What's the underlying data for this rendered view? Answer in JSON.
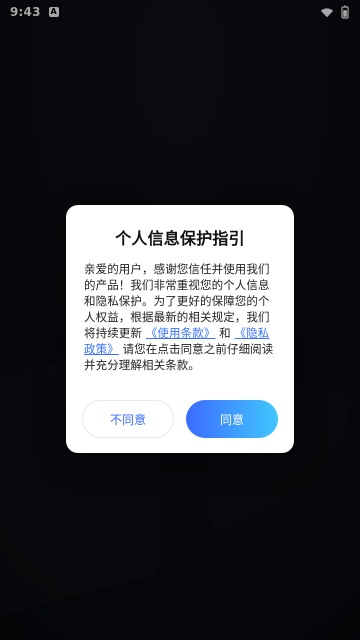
{
  "status_bar": {
    "time": "9:43",
    "indicator_letter": "A"
  },
  "dialog": {
    "title": "个人信息保护指引",
    "body_part1": "亲爱的用户，感谢您信任并使用我们的产品！我们非常重视您的个人信息和隐私保护。为了更好的保障您的个人权益，根据最新的相关规定，我们将持续更新",
    "terms_link": "《使用条款》",
    "and_text": "和",
    "privacy_link": "《隐私政策》",
    "body_part2": "请您在点击同意之前仔细阅读并充分理解相关条款。",
    "buttons": {
      "disagree": "不同意",
      "agree": "同意"
    }
  },
  "colors": {
    "link": "#3b73ff",
    "agree_gradient_start": "#3b6bff",
    "agree_gradient_end": "#41c7ff",
    "disagree_text": "#3b6bff"
  },
  "icons": {
    "wifi": "wifi-icon",
    "battery": "battery-icon",
    "app_indicator": "a-icon"
  }
}
